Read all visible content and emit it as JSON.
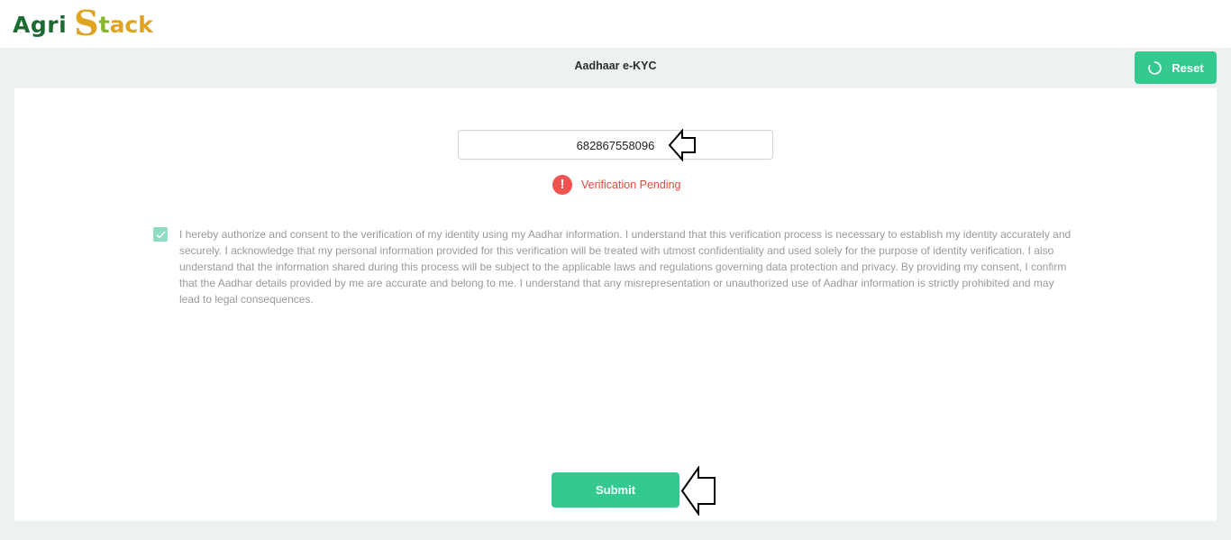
{
  "header": {
    "logo_agri": "Agri",
    "logo_s": "S",
    "logo_tack_t": "t",
    "logo_tack_rest": "ack"
  },
  "page": {
    "title": "Aadhaar e-KYC",
    "reset_label": "Reset"
  },
  "form": {
    "aadhaar_value": "682867558096",
    "status_icon": "!",
    "status_text": "Verification Pending",
    "consent_checked": true,
    "consent_text": "I hereby authorize and consent to the verification of my identity using my Aadhar information. I understand that this verification process is necessary to establish my identity accurately and securely. I acknowledge that my personal information provided for this verification will be treated with utmost confidentiality and used solely for the purpose of identity verification. I also understand that the information shared during this process will be subject to the applicable laws and regulations governing data protection and privacy. By providing my consent, I confirm that the Aadhar details provided by me are accurate and belong to me. I understand that any misrepresentation or unauthorized use of Aadhar information is strictly prohibited and may lead to legal consequences.",
    "submit_label": "Submit"
  },
  "colors": {
    "accent": "#34c98f",
    "error": "#f0534f",
    "logo_green": "#1d6b33",
    "logo_gold": "#e0a322"
  },
  "icons": {
    "reset": "refresh-icon",
    "status": "alert-icon",
    "checkbox": "check-icon",
    "pointer": "left-arrow-icon"
  }
}
